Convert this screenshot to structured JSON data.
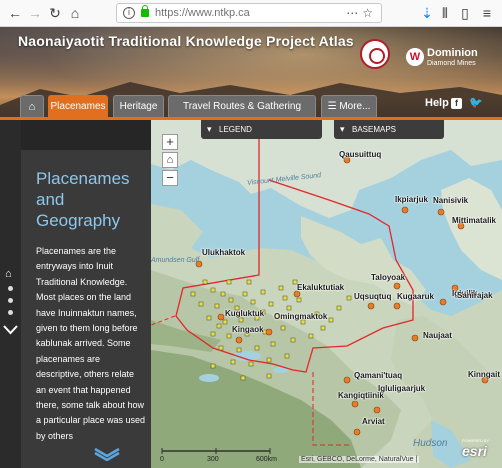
{
  "browser": {
    "url": "https://www.ntkp.ca",
    "back_icon": "back-arrow-icon",
    "forward_icon": "forward-arrow-icon",
    "reload_icon": "reload-icon",
    "home_icon": "home-icon"
  },
  "header": {
    "title": "Naonaiyaotit Traditional Knowledge Project Atlas",
    "brand_main": "Dominion",
    "brand_sub": "Diamond Mines"
  },
  "nav": {
    "tabs": [
      {
        "label": "Placenames",
        "active": true
      },
      {
        "label": "Heritage",
        "active": false
      },
      {
        "label": "Travel Routes & Gathering Places",
        "active": false
      },
      {
        "label": "More...",
        "active": false
      }
    ],
    "help_label": "Help",
    "accent_color": "#e0701f"
  },
  "panel": {
    "title": "Placenames and Geography",
    "body": "Placenames are the entryways into Inuit Traditional Knowledge. Most places on the land have Inuinnaktun names, given to them long before kablunak arrived. Some placenames are descriptive, others relate an event that happened there, some talk about how a particular place was used by others"
  },
  "map": {
    "legend_label": "LEGEND",
    "basemaps_label": "BASEMAPS",
    "zoom_in": "+",
    "zoom_out": "−",
    "attribution": "Esri, GEBCO, DeLorme, NaturalVue |",
    "esri_brand": "esri",
    "esri_powered": "POWERED BY",
    "scale": {
      "ticks": [
        "0",
        "300",
        "600km"
      ]
    },
    "places": [
      {
        "name": "Qausuittuq"
      },
      {
        "name": "Ikpiarjuk"
      },
      {
        "name": "Nanisivik"
      },
      {
        "name": "Mittimatalik"
      },
      {
        "name": "Ulukhaktok"
      },
      {
        "name": "Taloyoak"
      },
      {
        "name": "Igluligaarjuk"
      },
      {
        "name": "Kugluktuk"
      },
      {
        "name": "Ekaluktutiak"
      },
      {
        "name": "Uqsuqtuq"
      },
      {
        "name": "Kugaaruk"
      },
      {
        "name": "Igluilik"
      },
      {
        "name": "Sanirajak"
      },
      {
        "name": "Omingmaktok"
      },
      {
        "name": "Kingaok"
      },
      {
        "name": "Naujaat"
      },
      {
        "name": "Qamani'tuaq"
      },
      {
        "name": "Kangiqtiinik"
      },
      {
        "name": "Kinngait"
      },
      {
        "name": "Arviat"
      }
    ],
    "water": [
      {
        "name": "Amundsen Gulf"
      },
      {
        "name": "Viscount Melville Sound"
      },
      {
        "name": "Hudson"
      }
    ]
  }
}
